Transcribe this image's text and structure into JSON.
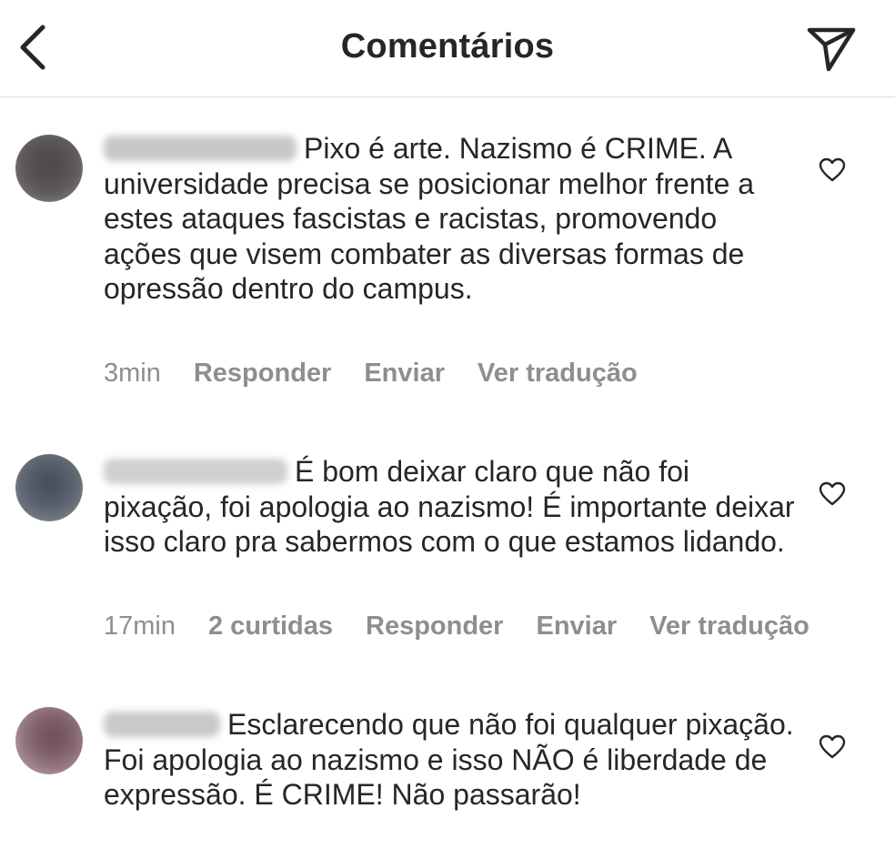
{
  "header": {
    "title": "Comentários"
  },
  "comments": [
    {
      "text": "Pixo é arte. Nazismo é CRIME.  A universidade precisa se posicionar melhor frente a estes ataques fascistas e racistas, promovendo ações que visem combater as diversas formas de opressão dentro do campus.",
      "time": "3min",
      "reply_label": "Responder",
      "send_label": "Enviar",
      "translate_label": "Ver tradução"
    },
    {
      "text": "É bom deixar claro que não foi pixação, foi apologia ao nazismo! É importante deixar isso claro pra sabermos com o que estamos lidando.",
      "time": "17min",
      "likes": "2 curtidas",
      "reply_label": "Responder",
      "send_label": "Enviar",
      "translate_label": "Ver tradução"
    },
    {
      "text": "Esclarecendo que não foi qualquer pixação. Foi apologia ao nazismo e isso NÃO é liberdade de expressão. É CRIME! Não passarão!"
    }
  ],
  "icons": {
    "back": "chevron-left-icon",
    "send": "paper-plane-icon",
    "like": "heart-outline-icon"
  },
  "colors": {
    "text": "#262626",
    "meta": "#8e8e8e",
    "divider": "#dbdbdb"
  }
}
